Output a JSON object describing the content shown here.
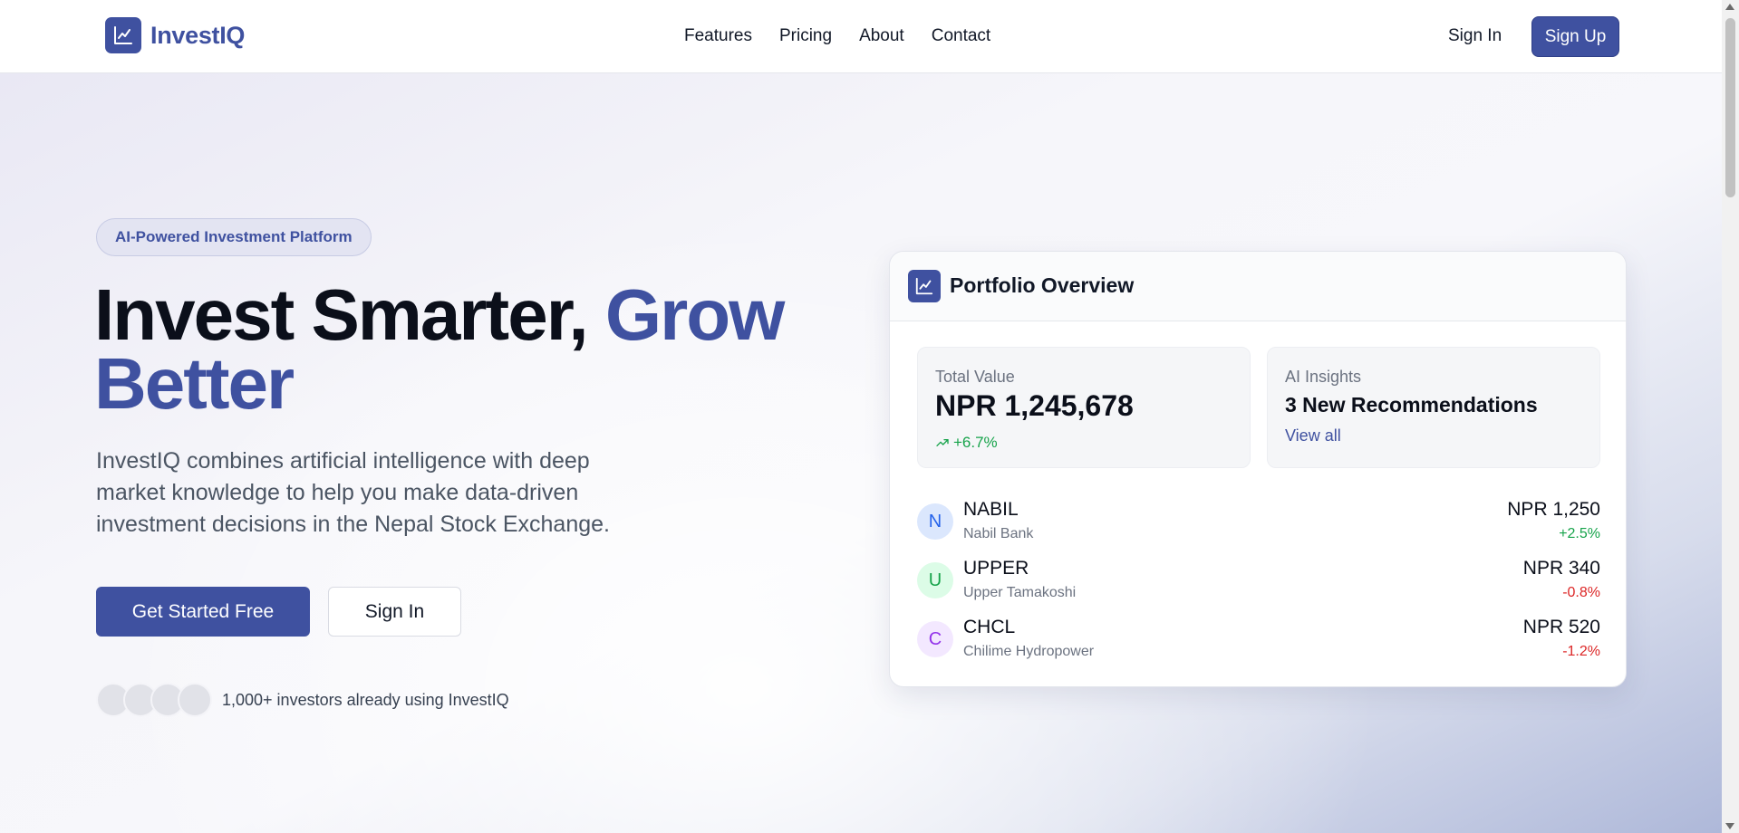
{
  "brand": {
    "name": "InvestIQ",
    "logo_icon": "chart-line-icon",
    "accent": "#3f51a0"
  },
  "nav": {
    "items": [
      {
        "label": "Features"
      },
      {
        "label": "Pricing"
      },
      {
        "label": "About"
      },
      {
        "label": "Contact"
      }
    ]
  },
  "header": {
    "signin_label": "Sign In",
    "signup_label": "Sign Up"
  },
  "hero": {
    "badge": "AI-Powered Investment Platform",
    "headline_part1": "Invest Smarter, ",
    "headline_accent": "Grow Better",
    "subtitle": "InvestIQ combines artificial intelligence with deep market knowledge to help you make data-driven investment decisions in the Nepal Stock Exchange.",
    "cta_primary": "Get Started Free",
    "cta_secondary": "Sign In",
    "social_proof": "1,000+ investors already using InvestIQ"
  },
  "card": {
    "title": "Portfolio Overview",
    "total": {
      "label": "Total Value",
      "value": "NPR 1,245,678",
      "change": "+6.7%",
      "change_icon": "trending-up-icon"
    },
    "ai": {
      "label": "AI Insights",
      "value": "3 New Recommendations",
      "link": "View all"
    },
    "stocks": [
      {
        "initial": "N",
        "symbol": "NABIL",
        "name": "Nabil Bank",
        "price": "NPR 1,250",
        "change": "+2.5%",
        "color": "#2563eb",
        "bg": "#dbe7fd",
        "change_color": "#16a34a"
      },
      {
        "initial": "U",
        "symbol": "UPPER",
        "name": "Upper Tamakoshi",
        "price": "NPR 340",
        "change": "-0.8%",
        "color": "#16a34a",
        "bg": "#dcfce7",
        "change_color": "#dc2626"
      },
      {
        "initial": "C",
        "symbol": "CHCL",
        "name": "Chilime Hydropower",
        "price": "NPR 520",
        "change": "-1.2%",
        "color": "#9333ea",
        "bg": "#f3e8ff",
        "change_color": "#dc2626"
      }
    ]
  }
}
